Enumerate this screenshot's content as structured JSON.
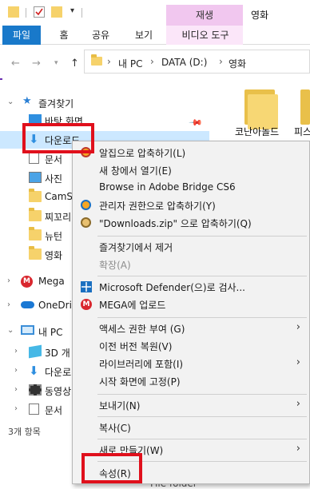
{
  "window": {
    "title": "영화",
    "context_tab_header": "재생"
  },
  "ribbon": {
    "tabs": [
      {
        "label": "파일"
      },
      {
        "label": "홈"
      },
      {
        "label": "공유"
      },
      {
        "label": "보기"
      },
      {
        "label": "비디오 도구"
      }
    ]
  },
  "address": {
    "crumbs": [
      "내 PC",
      "DATA (D:)",
      "영화"
    ]
  },
  "nav": {
    "quick_access": "즐겨찾기",
    "items": [
      {
        "label": "바탕 화면",
        "icon": "desktop-icon"
      },
      {
        "label": "다운로드",
        "icon": "download-arrow-icon"
      },
      {
        "label": "문서",
        "icon": "document-icon"
      },
      {
        "label": "사진",
        "icon": "pictures-icon"
      },
      {
        "label": "CamS",
        "icon": "folder-icon"
      },
      {
        "label": "찌꼬리",
        "icon": "folder-icon"
      },
      {
        "label": "뉴턴",
        "icon": "folder-icon"
      },
      {
        "label": "영화",
        "icon": "folder-icon"
      }
    ],
    "mega": "Mega",
    "onedrive": "OneDriv",
    "this_pc": "내 PC",
    "pc_items": [
      {
        "label": "3D 개",
        "icon": "3d-objects-icon"
      },
      {
        "label": "다운로",
        "icon": "download-arrow-icon"
      },
      {
        "label": "동영상",
        "icon": "video-icon"
      },
      {
        "label": "문서",
        "icon": "document-icon"
      }
    ]
  },
  "content": {
    "folders": [
      {
        "label": "코난아놀드"
      },
      {
        "label": "피스"
      }
    ],
    "bottom_text": "File folder"
  },
  "status": {
    "item_count": "3개 항목"
  },
  "context_menu": {
    "items": [
      {
        "label": "알집으로 압축하기(L)",
        "icon": "alzip-icon"
      },
      {
        "label": "새 창에서 열기(E)",
        "icon": ""
      },
      {
        "label": "Browse in Adobe Bridge CS6",
        "icon": ""
      },
      {
        "label": "관리자 권한으로 압축하기(Y)",
        "icon": "alzip-admin-icon"
      },
      {
        "label": "\"Downloads.zip\" 으로 압축하기(Q)",
        "icon": "alzip-icon"
      },
      {
        "label": "즐겨찾기에서 제거",
        "icon": ""
      },
      {
        "label": "확장(A)",
        "icon": "",
        "disabled": true
      },
      {
        "label": "Microsoft Defender(으)로 검사...",
        "icon": "defender-icon"
      },
      {
        "label": "MEGA에 업로드",
        "icon": "mega-icon"
      },
      {
        "label": "액세스 권한 부여 (G)",
        "icon": "",
        "submenu": true
      },
      {
        "label": "이전 버전 복원(V)",
        "icon": ""
      },
      {
        "label": "라이브러리에 포함(I)",
        "icon": "",
        "submenu": true
      },
      {
        "label": "시작 화면에 고정(P)",
        "icon": ""
      },
      {
        "label": "보내기(N)",
        "icon": "",
        "submenu": true
      },
      {
        "label": "복사(C)",
        "icon": ""
      },
      {
        "label": "새로 만들기(W)",
        "icon": "",
        "submenu": true
      },
      {
        "label": "속성(R)",
        "icon": ""
      }
    ]
  },
  "colors": {
    "file_tab": "#1979ca",
    "context_tab": "#f1c7ef",
    "selection": "#cce8ff",
    "highlight_box": "#e0101c"
  }
}
